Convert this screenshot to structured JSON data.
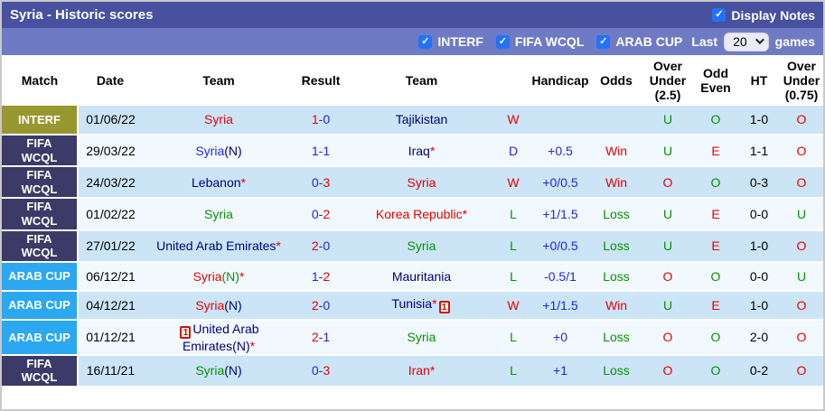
{
  "titlebar": {
    "title": "Syria - Historic scores",
    "display_notes_label": "Display Notes",
    "display_notes_checked": true
  },
  "filters": {
    "checkboxes": [
      {
        "label": "INTERF",
        "checked": true
      },
      {
        "label": "FIFA WCQL",
        "checked": true
      },
      {
        "label": "ARAB CUP",
        "checked": true
      }
    ],
    "last_label": "Last",
    "last_value": "20",
    "games_label": "games"
  },
  "colors": {
    "bar1_bg": "#47519f",
    "bar2_bg": "#6e7bc4",
    "checkbox_blue": "#2472f5",
    "badge_interf": "#97972f",
    "badge_fifa_wcql": "#3c3a67",
    "badge_arab_cup": "#2ba8f0",
    "row_stripe_blue": "#cbe5f7",
    "row_stripe_pale": "#f2f9fe",
    "text_red": "#e80000",
    "text_green": "#089000",
    "text_blue": "#2424dd",
    "text_navy": "#000080"
  },
  "table": {
    "headers": [
      "Match",
      "Date",
      "Team",
      "Result",
      "Team",
      "",
      "Handicap",
      "Odds",
      "Over Under (2.5)",
      "Odd Even",
      "HT",
      "Over Under (0.75)"
    ],
    "red_card_icon_label": "1",
    "rows": [
      {
        "badge": {
          "label": "INTERF",
          "type": "interf"
        },
        "date": "01/06/22",
        "home": {
          "parts": [
            {
              "t": "Syria",
              "c": "red"
            }
          ]
        },
        "result": [
          {
            "t": "1",
            "c": "red"
          },
          {
            "t": "-",
            "c": "blue"
          },
          {
            "t": "0",
            "c": "blue"
          }
        ],
        "away": {
          "parts": [
            {
              "t": "Tajikistan",
              "c": "navy"
            }
          ]
        },
        "wdl": {
          "t": "W",
          "c": "red"
        },
        "handicap": "",
        "odds": {
          "t": "",
          "c": "red"
        },
        "ou25": {
          "t": "U",
          "c": "green"
        },
        "oddeven": {
          "t": "O",
          "c": "green"
        },
        "ht": "1-0",
        "ou075": {
          "t": "O",
          "c": "red"
        }
      },
      {
        "badge": {
          "label": "FIFA WCQL",
          "type": "fifa"
        },
        "date": "29/03/22",
        "home": {
          "parts": [
            {
              "t": "Syria",
              "c": "blue"
            },
            {
              "t": "(N)",
              "c": "navy"
            }
          ]
        },
        "result": [
          {
            "t": "1",
            "c": "blue"
          },
          {
            "t": "-",
            "c": "blue"
          },
          {
            "t": "1",
            "c": "blue"
          }
        ],
        "away": {
          "parts": [
            {
              "t": "Iraq",
              "c": "navy"
            },
            {
              "t": "*",
              "c": "red"
            }
          ]
        },
        "wdl": {
          "t": "D",
          "c": "blue"
        },
        "handicap": "+0.5",
        "odds": {
          "t": "Win",
          "c": "red"
        },
        "ou25": {
          "t": "U",
          "c": "green"
        },
        "oddeven": {
          "t": "E",
          "c": "red"
        },
        "ht": "1-1",
        "ou075": {
          "t": "O",
          "c": "red"
        }
      },
      {
        "badge": {
          "label": "FIFA WCQL",
          "type": "fifa"
        },
        "date": "24/03/22",
        "home": {
          "parts": [
            {
              "t": "Lebanon",
              "c": "navy"
            },
            {
              "t": "*",
              "c": "red"
            }
          ]
        },
        "result": [
          {
            "t": "0",
            "c": "blue"
          },
          {
            "t": "-",
            "c": "blue"
          },
          {
            "t": "3",
            "c": "red"
          }
        ],
        "away": {
          "parts": [
            {
              "t": "Syria",
              "c": "red"
            }
          ]
        },
        "wdl": {
          "t": "W",
          "c": "red"
        },
        "handicap": "+0/0.5",
        "odds": {
          "t": "Win",
          "c": "red"
        },
        "ou25": {
          "t": "O",
          "c": "red"
        },
        "oddeven": {
          "t": "O",
          "c": "green"
        },
        "ht": "0-3",
        "ou075": {
          "t": "O",
          "c": "red"
        }
      },
      {
        "badge": {
          "label": "FIFA WCQL",
          "type": "fifa"
        },
        "date": "01/02/22",
        "home": {
          "parts": [
            {
              "t": "Syria",
              "c": "green"
            }
          ]
        },
        "result": [
          {
            "t": "0",
            "c": "blue"
          },
          {
            "t": "-",
            "c": "blue"
          },
          {
            "t": "2",
            "c": "red"
          }
        ],
        "away": {
          "parts": [
            {
              "t": "Korea Republic",
              "c": "red"
            },
            {
              "t": "*",
              "c": "red"
            }
          ]
        },
        "wdl": {
          "t": "L",
          "c": "green"
        },
        "handicap": "+1/1.5",
        "odds": {
          "t": "Loss",
          "c": "green"
        },
        "ou25": {
          "t": "U",
          "c": "green"
        },
        "oddeven": {
          "t": "E",
          "c": "red"
        },
        "ht": "0-0",
        "ou075": {
          "t": "U",
          "c": "green"
        }
      },
      {
        "badge": {
          "label": "FIFA WCQL",
          "type": "fifa"
        },
        "date": "27/01/22",
        "home": {
          "parts": [
            {
              "t": "United Arab Emirates",
              "c": "navy"
            },
            {
              "t": "*",
              "c": "red"
            }
          ]
        },
        "result": [
          {
            "t": "2",
            "c": "red"
          },
          {
            "t": "-",
            "c": "blue"
          },
          {
            "t": "0",
            "c": "blue"
          }
        ],
        "away": {
          "parts": [
            {
              "t": "Syria",
              "c": "green"
            }
          ]
        },
        "wdl": {
          "t": "L",
          "c": "green"
        },
        "handicap": "+0/0.5",
        "odds": {
          "t": "Loss",
          "c": "green"
        },
        "ou25": {
          "t": "U",
          "c": "green"
        },
        "oddeven": {
          "t": "E",
          "c": "red"
        },
        "ht": "1-0",
        "ou075": {
          "t": "O",
          "c": "red"
        }
      },
      {
        "badge": {
          "label": "ARAB CUP",
          "type": "arab"
        },
        "date": "06/12/21",
        "home": {
          "parts": [
            {
              "t": "Syria",
              "c": "red"
            },
            {
              "t": "(N)",
              "c": "green"
            },
            {
              "t": "*",
              "c": "red"
            }
          ]
        },
        "result": [
          {
            "t": "1",
            "c": "blue"
          },
          {
            "t": "-",
            "c": "blue"
          },
          {
            "t": "2",
            "c": "red"
          }
        ],
        "away": {
          "parts": [
            {
              "t": "Mauritania",
              "c": "navy"
            }
          ]
        },
        "wdl": {
          "t": "L",
          "c": "green"
        },
        "handicap": "-0.5/1",
        "odds": {
          "t": "Loss",
          "c": "green"
        },
        "ou25": {
          "t": "O",
          "c": "red"
        },
        "oddeven": {
          "t": "O",
          "c": "green"
        },
        "ht": "0-0",
        "ou075": {
          "t": "U",
          "c": "green"
        }
      },
      {
        "badge": {
          "label": "ARAB CUP",
          "type": "arab"
        },
        "date": "04/12/21",
        "home": {
          "parts": [
            {
              "t": "Syria",
              "c": "red"
            },
            {
              "t": "(N)",
              "c": "navy"
            }
          ]
        },
        "result": [
          {
            "t": "2",
            "c": "red"
          },
          {
            "t": "-",
            "c": "blue"
          },
          {
            "t": "0",
            "c": "blue"
          }
        ],
        "away": {
          "parts": [
            {
              "t": "Tunisia",
              "c": "navy"
            },
            {
              "t": "*",
              "c": "red"
            }
          ],
          "icon": "after"
        },
        "wdl": {
          "t": "W",
          "c": "red"
        },
        "handicap": "+1/1.5",
        "odds": {
          "t": "Win",
          "c": "red"
        },
        "ou25": {
          "t": "U",
          "c": "green"
        },
        "oddeven": {
          "t": "E",
          "c": "red"
        },
        "ht": "1-0",
        "ou075": {
          "t": "O",
          "c": "red"
        }
      },
      {
        "badge": {
          "label": "ARAB CUP",
          "type": "arab"
        },
        "date": "01/12/21",
        "home": {
          "parts": [
            {
              "t": "United Arab Emirates(N)",
              "c": "navy"
            },
            {
              "t": "*",
              "c": "red"
            }
          ],
          "icon": "before"
        },
        "result": [
          {
            "t": "2",
            "c": "red"
          },
          {
            "t": "-",
            "c": "blue"
          },
          {
            "t": "1",
            "c": "blue"
          }
        ],
        "away": {
          "parts": [
            {
              "t": "Syria",
              "c": "green"
            }
          ]
        },
        "wdl": {
          "t": "L",
          "c": "green"
        },
        "handicap": "+0",
        "odds": {
          "t": "Loss",
          "c": "green"
        },
        "ou25": {
          "t": "O",
          "c": "red"
        },
        "oddeven": {
          "t": "O",
          "c": "green"
        },
        "ht": "2-0",
        "ou075": {
          "t": "O",
          "c": "red"
        }
      },
      {
        "badge": {
          "label": "FIFA WCQL",
          "type": "fifa"
        },
        "date": "16/11/21",
        "home": {
          "parts": [
            {
              "t": "Syria",
              "c": "green"
            },
            {
              "t": "(N)",
              "c": "navy"
            }
          ]
        },
        "result": [
          {
            "t": "0",
            "c": "blue"
          },
          {
            "t": "-",
            "c": "blue"
          },
          {
            "t": "3",
            "c": "red"
          }
        ],
        "away": {
          "parts": [
            {
              "t": "Iran",
              "c": "red"
            },
            {
              "t": "*",
              "c": "red"
            }
          ]
        },
        "wdl": {
          "t": "L",
          "c": "green"
        },
        "handicap": "+1",
        "odds": {
          "t": "Loss",
          "c": "green"
        },
        "ou25": {
          "t": "O",
          "c": "red"
        },
        "oddeven": {
          "t": "O",
          "c": "green"
        },
        "ht": "0-2",
        "ou075": {
          "t": "O",
          "c": "red"
        }
      }
    ]
  }
}
